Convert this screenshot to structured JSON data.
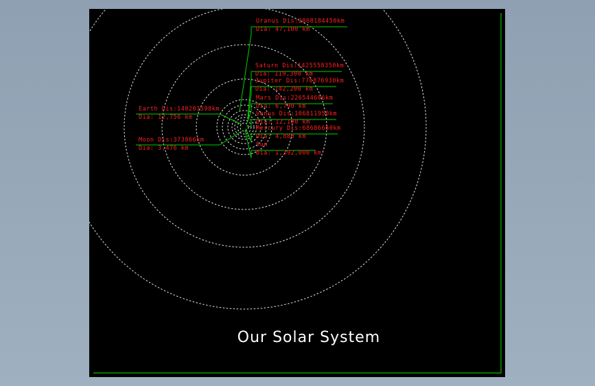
{
  "title": "Our Solar System",
  "colors": {
    "background": "#9aabbd",
    "sheet": "#000000",
    "border": "#00c000",
    "leader": "#00d000",
    "label": "#ff2020",
    "orbit": "#e8e8e8",
    "title": "#ffffff"
  },
  "bodies": [
    {
      "name": "Uranus",
      "distance_label": "Uranus Dis:2868184450km",
      "diameter_label": "Dia: 47,100 km"
    },
    {
      "name": "Saturn",
      "distance_label": "Saturn Dis:1425558350km",
      "diameter_label": "Dia: 119,300 km"
    },
    {
      "name": "Jupiter",
      "distance_label": "Jupiter Dis:776876930km",
      "diameter_label": "Dia: 142,200 km"
    },
    {
      "name": "Mars",
      "distance_label": "Mars Dis:226544606km",
      "diameter_label": "Dia: 6,790 km"
    },
    {
      "name": "Venus",
      "distance_label": "Venus Dis:106811950km",
      "diameter_label": "Dia: 12,100 km"
    },
    {
      "name": "Mercury",
      "distance_label": "Mercury Dis:68686660km",
      "diameter_label": "Dia: 4,880 km"
    },
    {
      "name": "Sun",
      "distance_label": "Sun",
      "diameter_label": "Dia: 1,392,000 km"
    },
    {
      "name": "Earth",
      "distance_label": "Earth Dis:148201598km",
      "diameter_label": "Dia: 12,756 km"
    },
    {
      "name": "Moon",
      "distance_label": "Moon Dis:373866km",
      "diameter_label": "Dia: 3,476 km"
    }
  ]
}
